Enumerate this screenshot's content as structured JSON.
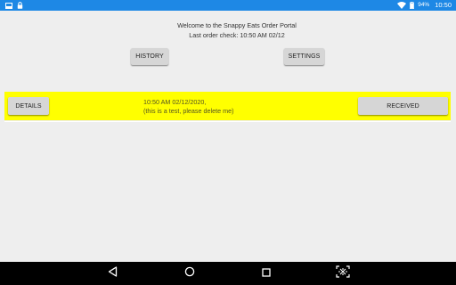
{
  "status_bar": {
    "battery_percent": "94%",
    "time": "10:50",
    "left_icons": [
      "screenshot-icon",
      "lock-icon"
    ],
    "right_icons": [
      "wifi-icon",
      "battery-icon"
    ],
    "color": "#1e88e5"
  },
  "header": {
    "welcome": "Welcome to the Snappy Eats Order Portal",
    "last_check": "Last order check: 10:50 AM 02/12"
  },
  "buttons": {
    "history": "HISTORY",
    "settings": "SETTINGS"
  },
  "orders": [
    {
      "details_label": "DETAILS",
      "line1": "10:50 AM 02/12/2020,",
      "line2": "(this is a test, please delete me)",
      "status_label": "RECEIVED",
      "highlight_color": "#ffff00"
    }
  ],
  "nav_bar": {
    "icons": [
      "back-icon",
      "home-icon",
      "recents-icon",
      "screen-capture-icon"
    ]
  }
}
